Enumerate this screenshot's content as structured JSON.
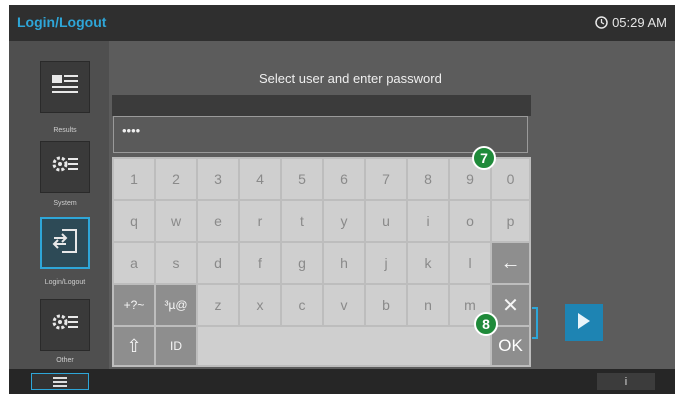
{
  "header": {
    "title": "Login/Logout",
    "time": "05:29 AM"
  },
  "sidebar": [
    {
      "label": "Results",
      "icon": "results-icon"
    },
    {
      "label": "System",
      "icon": "system-icon"
    },
    {
      "label": "Login/Logout",
      "icon": "login-logout-icon",
      "active": true
    },
    {
      "label": "Other",
      "icon": "other-icon"
    }
  ],
  "main": {
    "instruction": "Select user and enter password"
  },
  "password": {
    "value": "••••"
  },
  "keyboard": {
    "row1": [
      "1",
      "2",
      "3",
      "4",
      "5",
      "6",
      "7",
      "8",
      "9",
      "0"
    ],
    "row2": [
      "q",
      "w",
      "e",
      "r",
      "t",
      "y",
      "u",
      "i",
      "o",
      "p"
    ],
    "row3": [
      "a",
      "s",
      "d",
      "f",
      "g",
      "h",
      "j",
      "k",
      "l"
    ],
    "row4": [
      "+?~",
      "³µ@",
      "z",
      "x",
      "c",
      "v",
      "b",
      "n",
      "m"
    ],
    "backspace": "←",
    "clear": "✕",
    "ok": "OK",
    "shift": "⇧",
    "id": "ID"
  },
  "callouts": {
    "one": "7",
    "two": "8"
  },
  "footer": {
    "info": "i"
  },
  "colors": {
    "accent": "#2ea6d8",
    "badge": "#1f8a3a"
  }
}
